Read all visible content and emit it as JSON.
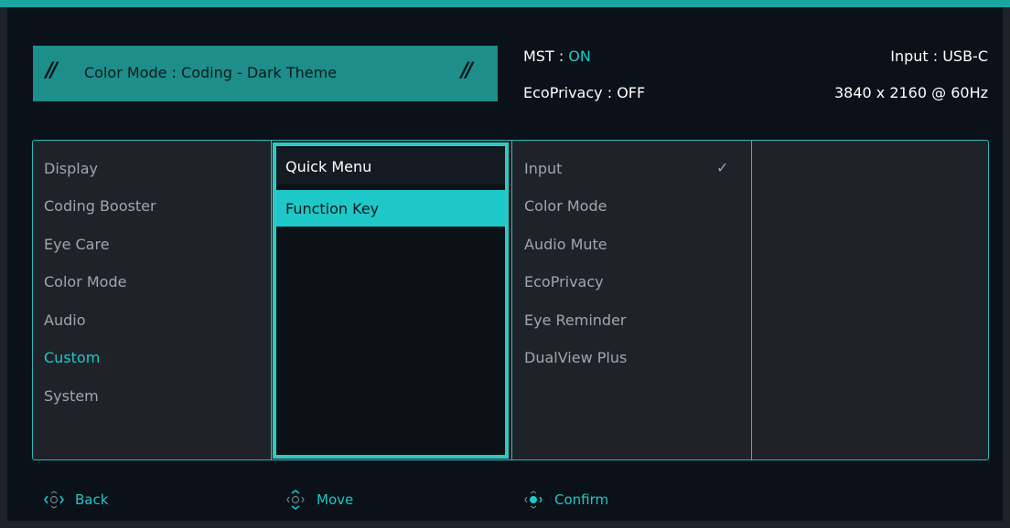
{
  "header": {
    "color_mode_text": "Color Mode : Coding - Dark Theme",
    "mst_label": "MST : ",
    "mst_value": "ON",
    "ecoprivacy": "EcoPrivacy : OFF",
    "input": "Input : USB-C",
    "resolution": "3840 x 2160 @ 60Hz"
  },
  "menu": {
    "categories": [
      "Display",
      "Coding Booster",
      "Eye Care",
      "Color Mode",
      "Audio",
      "Custom",
      "System"
    ],
    "active_category": "Custom",
    "submenu": [
      "Quick Menu",
      "Function Key"
    ],
    "selected_submenu": "Function Key",
    "options": [
      "Input",
      "Color Mode",
      "Audio Mute",
      "EcoPrivacy",
      "Eye Reminder",
      "DualView Plus"
    ],
    "checked_option": "Input"
  },
  "footer": {
    "back": "Back",
    "move": "Move",
    "confirm": "Confirm"
  },
  "colors": {
    "accent": "#1ec8c8",
    "banner": "#1d8e8a",
    "border": "#2bb9b5"
  },
  "icons": {
    "banner_left": "double-slash-icon",
    "banner_right": "double-slash-icon",
    "checked": "check-icon",
    "back": "joystick-left-right-icon",
    "move": "joystick-up-down-icon",
    "confirm": "joystick-press-icon"
  }
}
